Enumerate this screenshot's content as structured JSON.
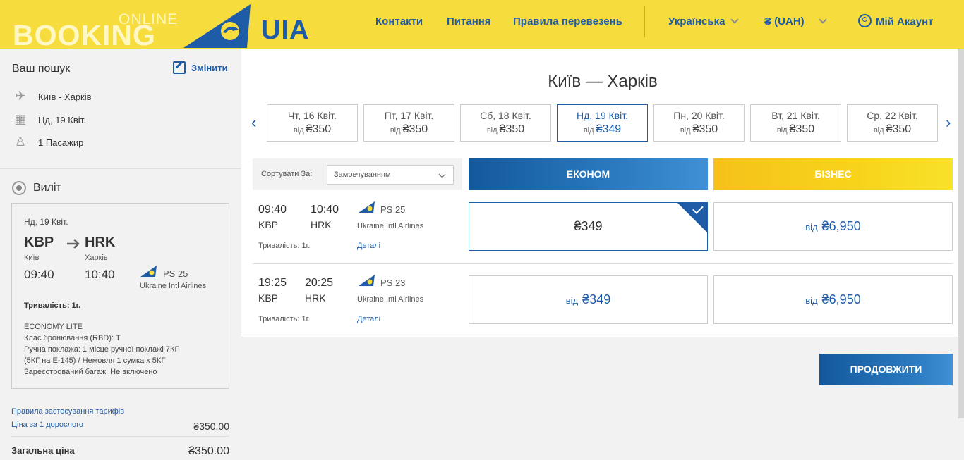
{
  "brand": {
    "booking": "BOOKING",
    "online": "ONLINE",
    "uia": "UIA",
    "colors": {
      "header": "#f7dc3d",
      "primary": "#1e5ca8",
      "business": "#f6c11a"
    }
  },
  "nav": {
    "contacts": "Контакти",
    "questions": "Питання",
    "rules": "Правила перевезень",
    "language": "Українська",
    "currency": "₴ (UAH)",
    "account": "Мій Акаунт"
  },
  "sidebar": {
    "search_title": "Ваш пошук",
    "change": "Змінити",
    "route": "Київ - Харків",
    "date": "Нд, 19 Квіт.",
    "passengers": "1 Пасажир",
    "departure_label": "Виліт",
    "card": {
      "date": "Нд, 19 Квіт.",
      "from_code": "KBP",
      "to_code": "HRK",
      "from_city": "Київ",
      "to_city": "Харків",
      "dep_time": "09:40",
      "arr_time": "10:40",
      "flight": "PS 25",
      "airline": "Ukraine Intl Airlines",
      "duration": "Тривалість: 1г.",
      "fare_name": "ECONOMY LITE",
      "booking_class": "Клас бронювання (RBD):  T",
      "hand_luggage_1": "Ручна поклажа: 1 місце ручної поклажі 7КГ",
      "hand_luggage_2": "(5КГ на E-145) / Немовля 1 сумка х 5КГ",
      "checked_bag": "Зареєстрований багаж: Не включено"
    },
    "tariff_rules": "Правила застосування тарифів",
    "adult_price_label": "Ціна за 1 дорослого",
    "adult_price": "₴350.00",
    "total_label": "Загальна ціна",
    "total_price": "₴350.00"
  },
  "main": {
    "route_title": "Київ — Харків",
    "prev_arrow": "‹",
    "next_arrow": "›",
    "dates": [
      {
        "label": "Чт, 16 Квіт.",
        "from": "від",
        "price": "₴350"
      },
      {
        "label": "Пт, 17 Квіт.",
        "from": "від",
        "price": "₴350"
      },
      {
        "label": "Сб, 18 Квіт.",
        "from": "від",
        "price": "₴350"
      },
      {
        "label": "Нд, 19 Квіт.",
        "from": "від",
        "price": "₴349"
      },
      {
        "label": "Пн, 20 Квіт.",
        "from": "від",
        "price": "₴350"
      },
      {
        "label": "Вт, 21 Квіт.",
        "from": "від",
        "price": "₴350"
      },
      {
        "label": "Ср, 22 Квіт.",
        "from": "від",
        "price": "₴350"
      }
    ],
    "sort_label": "Сортувати За:",
    "sort_value": "Замовчуванням",
    "economy": "ЕКОНОМ",
    "business": "БІЗНЕС",
    "flights": [
      {
        "dep": "09:40",
        "arr": "10:40",
        "from": "KBP",
        "to": "HRK",
        "flight": "PS 25",
        "airline": "Ukraine Intl Airlines",
        "duration": "Тривалість: 1г.",
        "details": "Деталі",
        "econ_price": "₴349",
        "bus_from": "від",
        "bus_price": "₴6,950"
      },
      {
        "dep": "19:25",
        "arr": "20:25",
        "from": "KBP",
        "to": "HRK",
        "flight": "PS 23",
        "airline": "Ukraine Intl Airlines",
        "duration": "Тривалість: 1г.",
        "details": "Деталі",
        "econ_from": "від",
        "econ_price": "₴349",
        "bus_from": "від",
        "bus_price": "₴6,950"
      }
    ],
    "continue": "ПРОДОВЖИТИ"
  }
}
